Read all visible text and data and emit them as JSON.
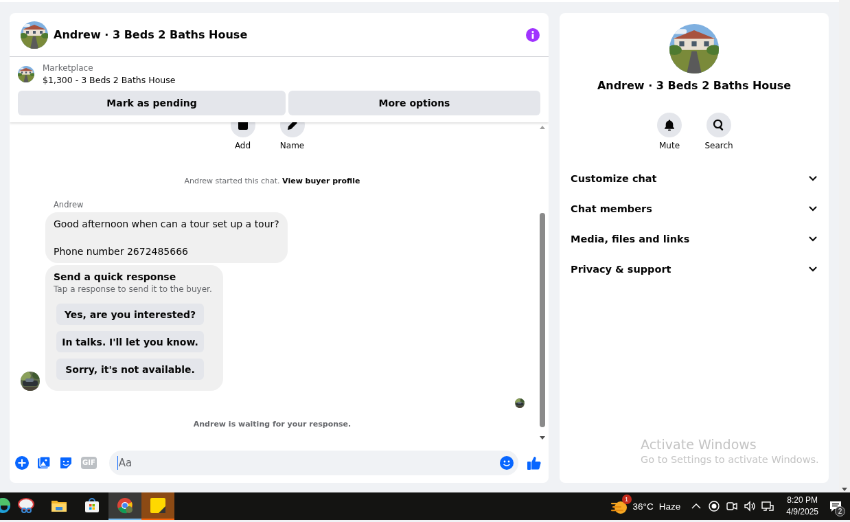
{
  "chat": {
    "title": "Andrew · 3 Beds 2 Baths House",
    "listing": {
      "label": "Marketplace",
      "summary": "$1,300 - 3 Beds 2 Baths House"
    },
    "actions": [
      "Mark as pending",
      "More options"
    ],
    "quick_actions": [
      {
        "label": "Add",
        "kind": "add"
      },
      {
        "label": "Name",
        "kind": "name"
      }
    ],
    "started_notice": {
      "text": "Andrew started this chat.",
      "link": "View buyer profile"
    },
    "sender": "Andrew",
    "message": [
      "Good afternoon when can a tour set up a tour?",
      "Phone number 2672485666"
    ],
    "quick_response": {
      "title": "Send a quick response",
      "hint": "Tap a response to send it to the buyer.",
      "options": [
        "Yes, are you interested?",
        "In talks. I'll let you know.",
        "Sorry, it's not available."
      ]
    },
    "waiting_notice": "Andrew is waiting for your response.",
    "composer": {
      "gif_label": "GIF",
      "placeholder": "Aa"
    }
  },
  "details": {
    "title": "Andrew · 3 Beds 2 Baths House",
    "actions": [
      {
        "label": "Mute",
        "kind": "bell"
      },
      {
        "label": "Search",
        "kind": "search"
      }
    ],
    "sections": [
      {
        "label": "Customize chat",
        "expanded": false
      },
      {
        "label": "Chat members",
        "expanded": false
      },
      {
        "label": "Media, files and links",
        "expanded": false
      },
      {
        "label": "Privacy & support",
        "expanded": false
      }
    ]
  },
  "activation_notice": {
    "title": "Activate Windows",
    "text": "Go to Settings to activate Windows."
  },
  "taskbar": {
    "apps": [
      {
        "kind": "edge",
        "selected": false,
        "attention": false
      },
      {
        "kind": "snip",
        "selected": false,
        "attention": false
      },
      {
        "kind": "folder",
        "selected": false,
        "attention": false
      },
      {
        "kind": "store",
        "selected": false,
        "attention": false
      },
      {
        "kind": "browser",
        "selected": true,
        "attention": false
      },
      {
        "kind": "notes",
        "selected": false,
        "attention": true
      }
    ],
    "weather": {
      "badge": "1",
      "temperature": "36°C",
      "condition": "Haze"
    },
    "clock": {
      "time": "8:20 PM",
      "date": "4/9/2025"
    },
    "notifications": {
      "count": "2"
    }
  }
}
